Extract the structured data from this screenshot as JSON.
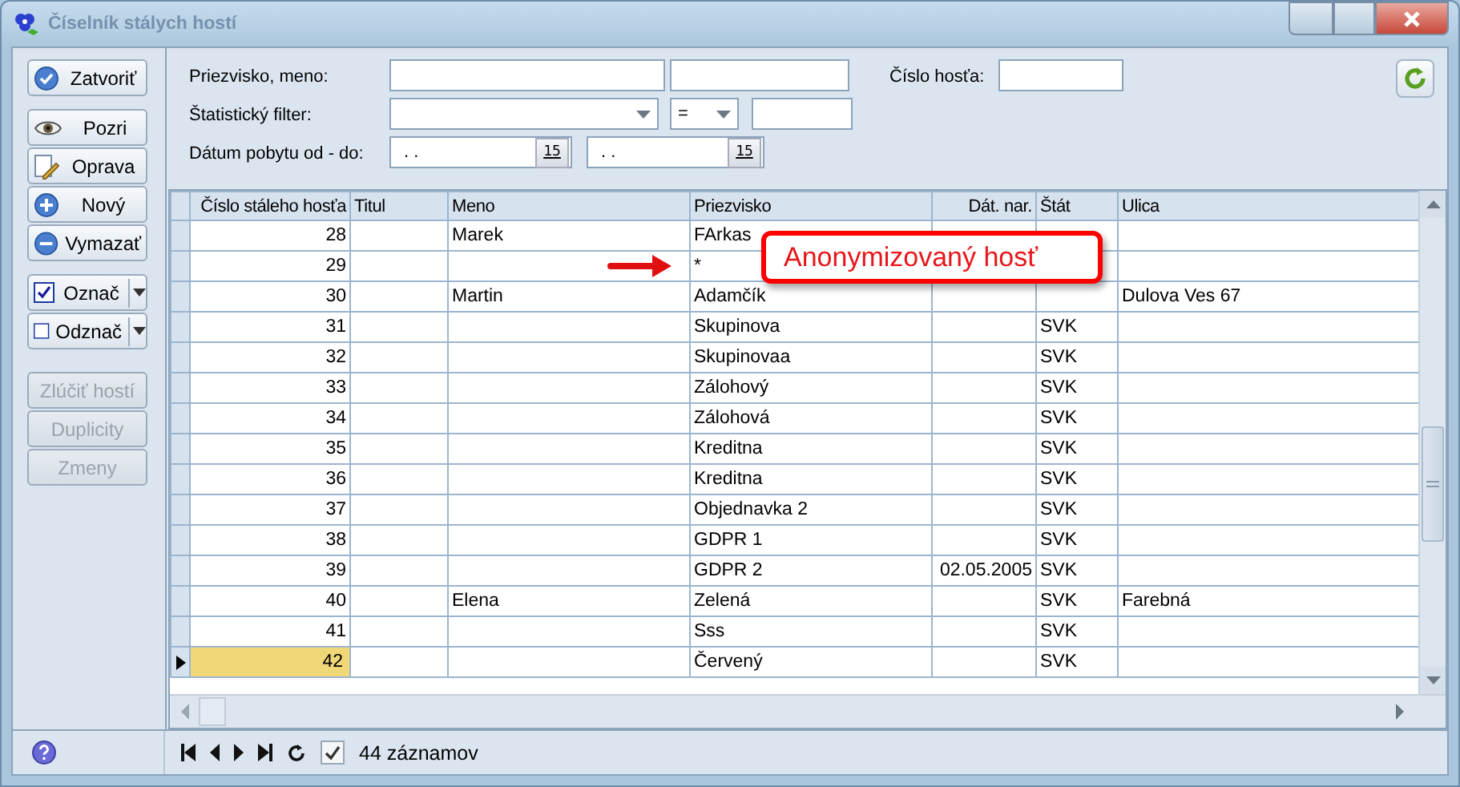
{
  "window": {
    "title": "Číselník stálych hostí"
  },
  "sidebar": {
    "buttons": [
      {
        "label": "Zatvoriť",
        "kind": "button",
        "disabled": false
      },
      {
        "label": "Pozri",
        "kind": "button",
        "disabled": false
      },
      {
        "label": "Oprava",
        "kind": "button",
        "disabled": false
      },
      {
        "label": "Nový",
        "kind": "button",
        "disabled": false
      },
      {
        "label": "Vymazať",
        "kind": "button",
        "disabled": false
      },
      {
        "label": "Označ",
        "kind": "split",
        "disabled": false
      },
      {
        "label": "Odznač",
        "kind": "split",
        "disabled": false
      },
      {
        "label": "Zlúčiť hostí",
        "kind": "button",
        "disabled": true
      },
      {
        "label": "Duplicity",
        "kind": "button",
        "disabled": true
      },
      {
        "label": "Zmeny",
        "kind": "button",
        "disabled": true
      }
    ]
  },
  "filters": {
    "name_label": "Priezvisko, meno:",
    "stat_label": "Štatistický filter:",
    "operator": "=",
    "date_label": "Dátum pobytu od - do:",
    "date_from": ". .",
    "date_from_button": "15",
    "date_to": ". .",
    "date_to_button": "15",
    "guest_number_label": "Číslo hosťa:"
  },
  "grid": {
    "columns": [
      "Číslo stáleho hosťa",
      "Titul",
      "Meno",
      "Priezvisko",
      "Dát. nar.",
      "Štát",
      "Ulica"
    ],
    "rows": [
      {
        "selected": false,
        "cells": [
          "28",
          "",
          "Marek",
          "FArkas",
          "",
          "",
          ""
        ]
      },
      {
        "selected": false,
        "cells": [
          "29",
          "",
          "",
          "*",
          "",
          "",
          ""
        ]
      },
      {
        "selected": false,
        "cells": [
          "30",
          "",
          "Martin",
          "Adamčík",
          "",
          "",
          "Dulova Ves 67"
        ]
      },
      {
        "selected": false,
        "cells": [
          "31",
          "",
          "",
          "Skupinova",
          "",
          "SVK",
          ""
        ]
      },
      {
        "selected": false,
        "cells": [
          "32",
          "",
          "",
          "Skupinovaa",
          "",
          "SVK",
          ""
        ]
      },
      {
        "selected": false,
        "cells": [
          "33",
          "",
          "",
          "Zálohový",
          "",
          "SVK",
          ""
        ]
      },
      {
        "selected": false,
        "cells": [
          "34",
          "",
          "",
          "Zálohová",
          "",
          "SVK",
          ""
        ]
      },
      {
        "selected": false,
        "cells": [
          "35",
          "",
          "",
          "Kreditna",
          "",
          "SVK",
          ""
        ]
      },
      {
        "selected": false,
        "cells": [
          "36",
          "",
          "",
          "Kreditna",
          "",
          "SVK",
          ""
        ]
      },
      {
        "selected": false,
        "cells": [
          "37",
          "",
          "",
          "Objednavka 2",
          "",
          "SVK",
          ""
        ]
      },
      {
        "selected": false,
        "cells": [
          "38",
          "",
          "",
          "GDPR 1",
          "",
          "SVK",
          ""
        ]
      },
      {
        "selected": false,
        "cells": [
          "39",
          "",
          "",
          "GDPR 2",
          "02.05.2005",
          "SVK",
          ""
        ]
      },
      {
        "selected": false,
        "cells": [
          "40",
          "",
          "Elena",
          "Zelená",
          "",
          "SVK",
          "Farebná"
        ]
      },
      {
        "selected": false,
        "cells": [
          "41",
          "",
          "",
          "Sss",
          "",
          "SVK",
          ""
        ]
      },
      {
        "selected": true,
        "cells": [
          "42",
          "",
          "",
          "Červený",
          "",
          "SVK",
          ""
        ]
      }
    ]
  },
  "callout": {
    "text": "Anonymizovaný hosť"
  },
  "status_bar": {
    "show_marked": true,
    "records": "44 záznamov"
  }
}
